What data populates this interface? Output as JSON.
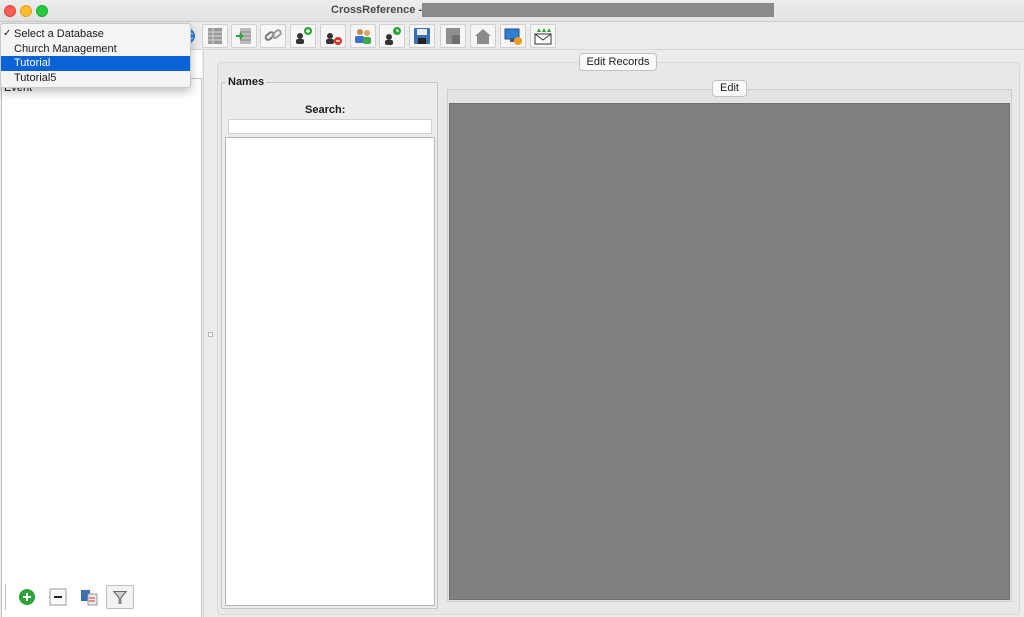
{
  "window": {
    "title": "CrossReference -"
  },
  "database_menu": {
    "items": [
      {
        "label": "Select a Database",
        "checked": true,
        "selected": false
      },
      {
        "label": "Church Management",
        "checked": false,
        "selected": false
      },
      {
        "label": "Tutorial",
        "checked": false,
        "selected": true
      },
      {
        "label": "Tutorial5",
        "checked": false,
        "selected": false
      }
    ],
    "check_mark": "✓"
  },
  "toolbar": {
    "icons": [
      "globe-icon",
      "table-icon",
      "list-export-icon",
      "link-icon",
      "add-person-icon",
      "remove-person-icon",
      "group-people-icon",
      "person-clock-icon",
      "save-disk-icon",
      "page-icon",
      "home-icon",
      "monitor-settings-icon",
      "email-upload-icon"
    ]
  },
  "left_panel": {
    "list_item": "Event"
  },
  "main": {
    "edit_records_label": "Edit Records",
    "names": {
      "title": "Names",
      "search_label": "Search:",
      "search_value": ""
    },
    "edit_label": "Edit"
  },
  "colors": {
    "selection": "#0a63d6",
    "edit_canvas": "#7f7f7f"
  }
}
